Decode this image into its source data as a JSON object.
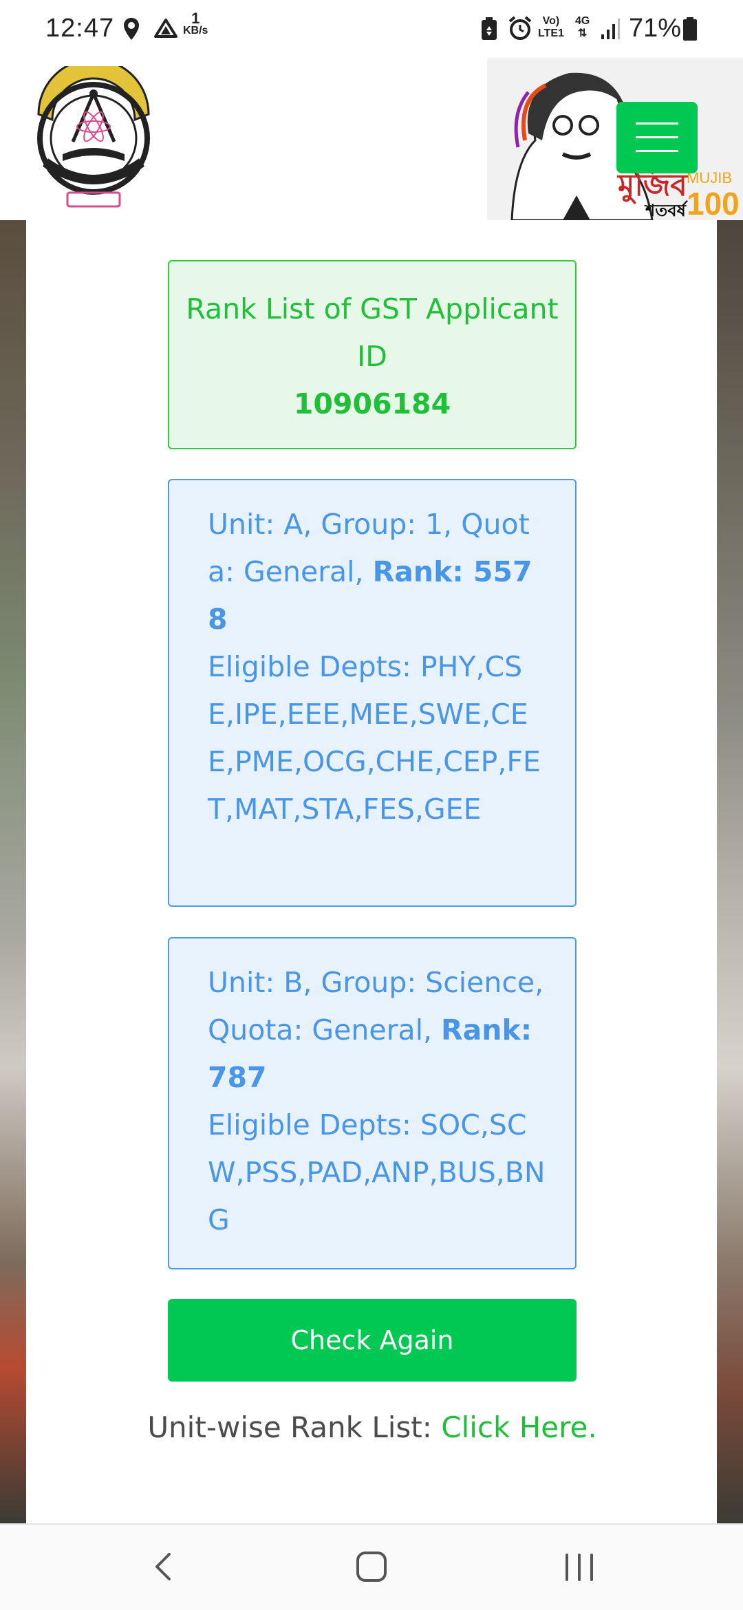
{
  "status_bar": {
    "time": "12:47",
    "speed_value": "1",
    "speed_unit": "KB/s",
    "volte": "Vo)",
    "lte": "LTE1",
    "network": "4G",
    "battery": "71%"
  },
  "header": {
    "logo_icon": "university-logo",
    "banner_icon": "mujib-100-banner",
    "banner_text": "MUJIB"
  },
  "result": {
    "title_line": "Rank List of GST Applicant ID",
    "applicant_id": "10906184"
  },
  "units": [
    {
      "prefix": "Unit: A, Group: 1, Quota: General,",
      "rank_label": "Rank: 5578",
      "depts_label": "Eligible Depts:",
      "depts": "PHY,CSE,IPE,EEE,MEE,SWE,CEE,PME,OCG,CHE,CEP,FET,MAT,STA,FES,GEE"
    },
    {
      "prefix": "Unit: B, Group: Science, Quota: General,",
      "rank_label": "Rank: 787",
      "depts_label": "Eligible Depts:",
      "depts": "SOC,SCW,PSS,PAD,ANP,BUS,BNG"
    }
  ],
  "actions": {
    "check_again": "Check Again",
    "unitwise_label": "Unit-wise Rank List:",
    "unitwise_link": "Click Here."
  },
  "colors": {
    "accent_green": "#00c853",
    "text_green": "#1fbf3a",
    "text_blue": "#4996e6"
  }
}
